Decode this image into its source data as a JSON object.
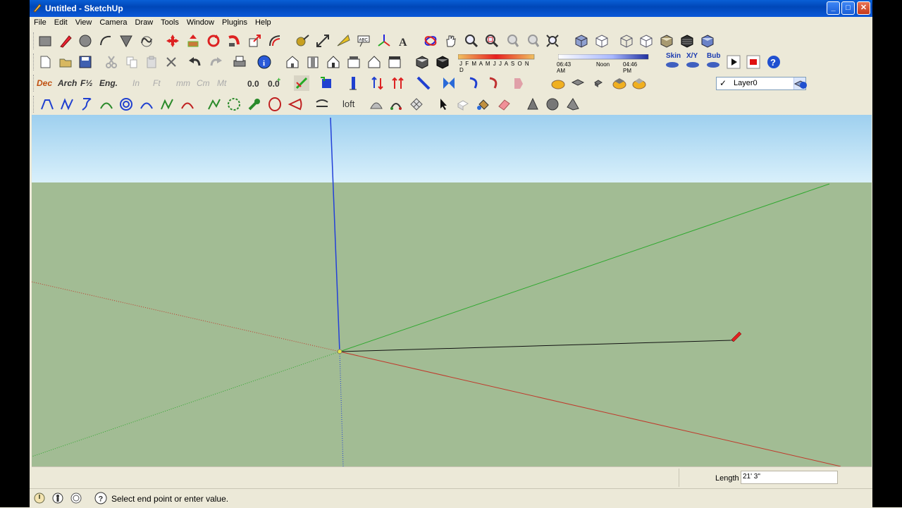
{
  "window": {
    "title": "Untitled - SketchUp",
    "minimize_label": "_",
    "maximize_label": "□",
    "close_label": "✕"
  },
  "menu": [
    "File",
    "Edit",
    "View",
    "Camera",
    "Draw",
    "Tools",
    "Window",
    "Plugins",
    "Help"
  ],
  "units_toolbar": {
    "dec": "Dec",
    "arch": "Arch",
    "frac": "F½",
    "eng": "Eng.",
    "in": "In",
    "ft": "Ft",
    "mm": "mm",
    "cm": "Cm",
    "mt": "Mt"
  },
  "shadow_settings": {
    "months": "J F M A M J J A S O N D",
    "time_start": "06:43 AM",
    "time_noon": "Noon",
    "time_end": "04:46 PM"
  },
  "plugin_buttons": {
    "skin": "Skin",
    "xy": "X/Y",
    "bub": "Bub"
  },
  "loft_label": "loft",
  "layer": {
    "current": "Layer0"
  },
  "measurements": {
    "label": "Length",
    "value": "21' 3\""
  },
  "status": {
    "text": "Select end point or enter value."
  },
  "colors": {
    "title_bar": "#0a5fd6",
    "sky": "#9ed0ef",
    "ground": "#a2bc94",
    "red_axis": "#c0392b",
    "green_axis": "#2ea82e",
    "blue_axis": "#2340d8"
  }
}
